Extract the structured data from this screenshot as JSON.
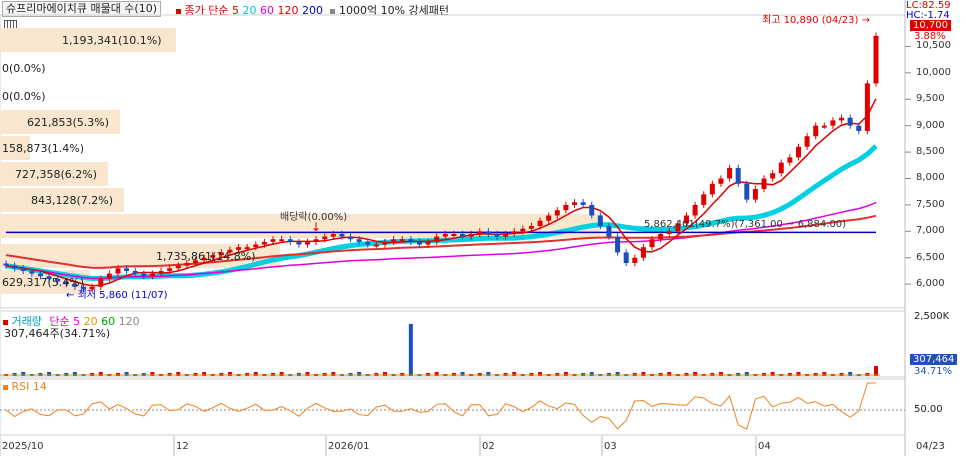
{
  "header": {
    "title": "슈프리마에이치큐 매물대 수(10)",
    "ma_label": "종가 단순",
    "ma_periods": [
      "5",
      "20",
      "60",
      "120",
      "200"
    ],
    "ma_colors": [
      "#e00000",
      "#00d0e0",
      "#e000e0",
      "#e00000",
      "#0000c0"
    ],
    "pattern_label": "1000억 10% 강세패턴"
  },
  "top_right": {
    "lc": "LC:82.59",
    "hc": "HC:-1.74",
    "last_price": "10,700",
    "change_pct": "3.88%"
  },
  "price_axis": [
    "10,500",
    "10,000",
    "9,500",
    "9,000",
    "8,500",
    "8,000",
    "7,500",
    "7,000",
    "6,500",
    "6,000"
  ],
  "volume_profile": [
    {
      "label": "1,193,341(10.1%)",
      "width": 176
    },
    {
      "label": "0(0.0%)",
      "width": 0
    },
    {
      "label": "0(0.0%)",
      "width": 0
    },
    {
      "label": "621,853(5.3%)",
      "width": 120
    },
    {
      "label": "158,873(1.4%)",
      "width": 30
    },
    {
      "label": "727,358(6.2%)",
      "width": 108
    },
    {
      "label": "843,128(7.2%)",
      "width": 124
    },
    {
      "label": "",
      "width": 600
    },
    {
      "label": "1,735,861(14.8%)",
      "width": 280
    },
    {
      "label": "629,317(5.4%)",
      "width": 90
    }
  ],
  "annotations": {
    "high": "최고 10,890 (04/23)",
    "low": "최저 5,860 (11/07)",
    "dividend": "배당락(0.00%)",
    "range": "5,862,401(49.7%)(7,361.00 ~ 6,884.00)"
  },
  "chart_data": {
    "type": "candlestick",
    "x_labels": [
      "2025/10",
      "12",
      "2026/01",
      "02",
      "03",
      "04",
      "04/23"
    ],
    "ylim": [
      5700,
      11000
    ],
    "closes": [
      6350,
      6300,
      6250,
      6200,
      6150,
      6100,
      6050,
      6000,
      5950,
      5900,
      5950,
      6100,
      6200,
      6300,
      6250,
      6200,
      6150,
      6200,
      6250,
      6300,
      6350,
      6400,
      6450,
      6500,
      6550,
      6600,
      6650,
      6700,
      6700,
      6750,
      6800,
      6850,
      6850,
      6800,
      6750,
      6800,
      6850,
      6900,
      6950,
      6900,
      6850,
      6800,
      6750,
      6750,
      6800,
      6850,
      6850,
      6800,
      6750,
      6800,
      6900,
      6950,
      6950,
      6900,
      6950,
      7000,
      6950,
      6900,
      6950,
      7000,
      7050,
      7100,
      7200,
      7300,
      7400,
      7500,
      7550,
      7500,
      7300,
      7100,
      6900,
      6600,
      6400,
      6500,
      6700,
      6850,
      6950,
      7000,
      7150,
      7300,
      7500,
      7700,
      7900,
      8000,
      8200,
      7900,
      7600,
      7800,
      8000,
      8100,
      8300,
      8400,
      8600,
      8800,
      9000,
      9000,
      9100,
      9150,
      9000,
      8900,
      9800,
      10700
    ]
  },
  "volume": {
    "label": "거래량",
    "ma_label": "단순",
    "ma_periods": [
      "5",
      "20",
      "60",
      "120"
    ],
    "ma_colors": [
      "#e000e0",
      "#d0a000",
      "#00a000",
      "#888888"
    ],
    "value_text": "307,464주(34.71%)",
    "axis_label": "2,500K",
    "current": "307,464",
    "pct": "34.71%"
  },
  "rsi": {
    "label": "RSI 14",
    "axis_label": "50.00"
  }
}
